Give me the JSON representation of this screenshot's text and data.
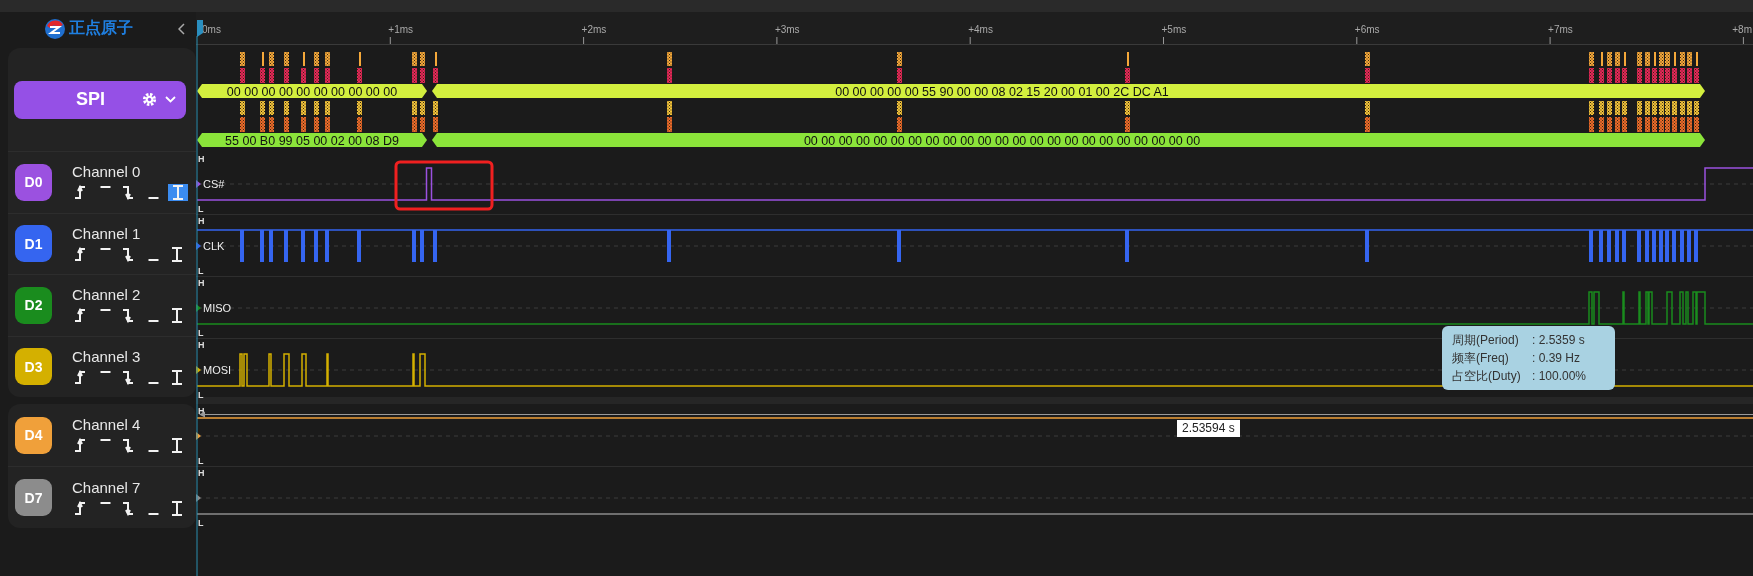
{
  "logo": {
    "text": "正点原子"
  },
  "ruler": {
    "ticks": [
      "0ms",
      "+1ms",
      "+2ms",
      "+3ms",
      "+4ms",
      "+5ms",
      "+6ms",
      "+7ms",
      "+8m"
    ]
  },
  "groups": [
    {
      "decoder": {
        "name": "SPI",
        "rows": [
          {
            "segments": [
              "00 00 00 00 00 00 00 00 00 00",
              "00 00 00 00 00 55 90 00 00 08 02 15 20 00 01 00 2C DC A1"
            ]
          },
          {
            "segments": [
              "55 00 B0 99 05 00 02 00 08 D9",
              "00 00 00 00 00 00 00 00 00 00 00 00 00 00 00 00 00 00 00 00 00 00 00"
            ]
          }
        ]
      },
      "channels": [
        {
          "badge": "D0",
          "name": "Channel 0",
          "color": "#9b51e0",
          "signal": "CS#",
          "high_label": "H",
          "low_label": "L",
          "triggers": [
            {
              "kind": "rising",
              "selected": false
            },
            {
              "kind": "high",
              "selected": false
            },
            {
              "kind": "falling",
              "selected": false
            },
            {
              "kind": "low",
              "selected": false
            },
            {
              "kind": "any",
              "selected": true
            }
          ]
        },
        {
          "badge": "D1",
          "name": "Channel 1",
          "color": "#3565f0",
          "signal": "CLK",
          "high_label": "H",
          "low_label": "L",
          "triggers": [
            {
              "kind": "rising",
              "selected": false
            },
            {
              "kind": "high",
              "selected": false
            },
            {
              "kind": "falling",
              "selected": false
            },
            {
              "kind": "low",
              "selected": false
            },
            {
              "kind": "any",
              "selected": false
            }
          ]
        },
        {
          "badge": "D2",
          "name": "Channel 2",
          "color": "#1a8c1e",
          "signal": "MISO",
          "high_label": "H",
          "low_label": "L",
          "triggers": [
            {
              "kind": "rising",
              "selected": false
            },
            {
              "kind": "high",
              "selected": false
            },
            {
              "kind": "falling",
              "selected": false
            },
            {
              "kind": "low",
              "selected": false
            },
            {
              "kind": "any",
              "selected": false
            }
          ]
        },
        {
          "badge": "D3",
          "name": "Channel 3",
          "color": "#d4b000",
          "signal": "MOSI",
          "high_label": "H",
          "low_label": "L",
          "triggers": [
            {
              "kind": "rising",
              "selected": false
            },
            {
              "kind": "high",
              "selected": false
            },
            {
              "kind": "falling",
              "selected": false
            },
            {
              "kind": "low",
              "selected": false
            },
            {
              "kind": "any",
              "selected": false
            }
          ]
        }
      ]
    },
    {
      "channels": [
        {
          "badge": "D4",
          "name": "Channel 4",
          "color": "#f0a03a",
          "high_label": "H",
          "low_label": "L",
          "triggers": [
            {
              "kind": "rising",
              "selected": false
            },
            {
              "kind": "high",
              "selected": false
            },
            {
              "kind": "falling",
              "selected": false
            },
            {
              "kind": "low",
              "selected": false
            },
            {
              "kind": "any",
              "selected": false
            }
          ]
        },
        {
          "badge": "D7",
          "name": "Channel 7",
          "color": "#8c8c8c",
          "high_label": "H",
          "low_label": "L",
          "triggers": [
            {
              "kind": "rising",
              "selected": false
            },
            {
              "kind": "high",
              "selected": false
            },
            {
              "kind": "falling",
              "selected": false
            },
            {
              "kind": "low",
              "selected": false
            },
            {
              "kind": "any",
              "selected": false
            }
          ]
        }
      ]
    }
  ],
  "measurement": {
    "tooltip": [
      {
        "label": "周期(Period)",
        "value": ": 2.5359 s"
      },
      {
        "label": "频率(Freq)",
        "value": ": 0.39 Hz"
      },
      {
        "label": "占空比(Duty)",
        "value": ": 100.00%"
      }
    ],
    "width_label": "2.53594 s"
  },
  "annotations": [
    {
      "kind": "rectangle"
    }
  ]
}
